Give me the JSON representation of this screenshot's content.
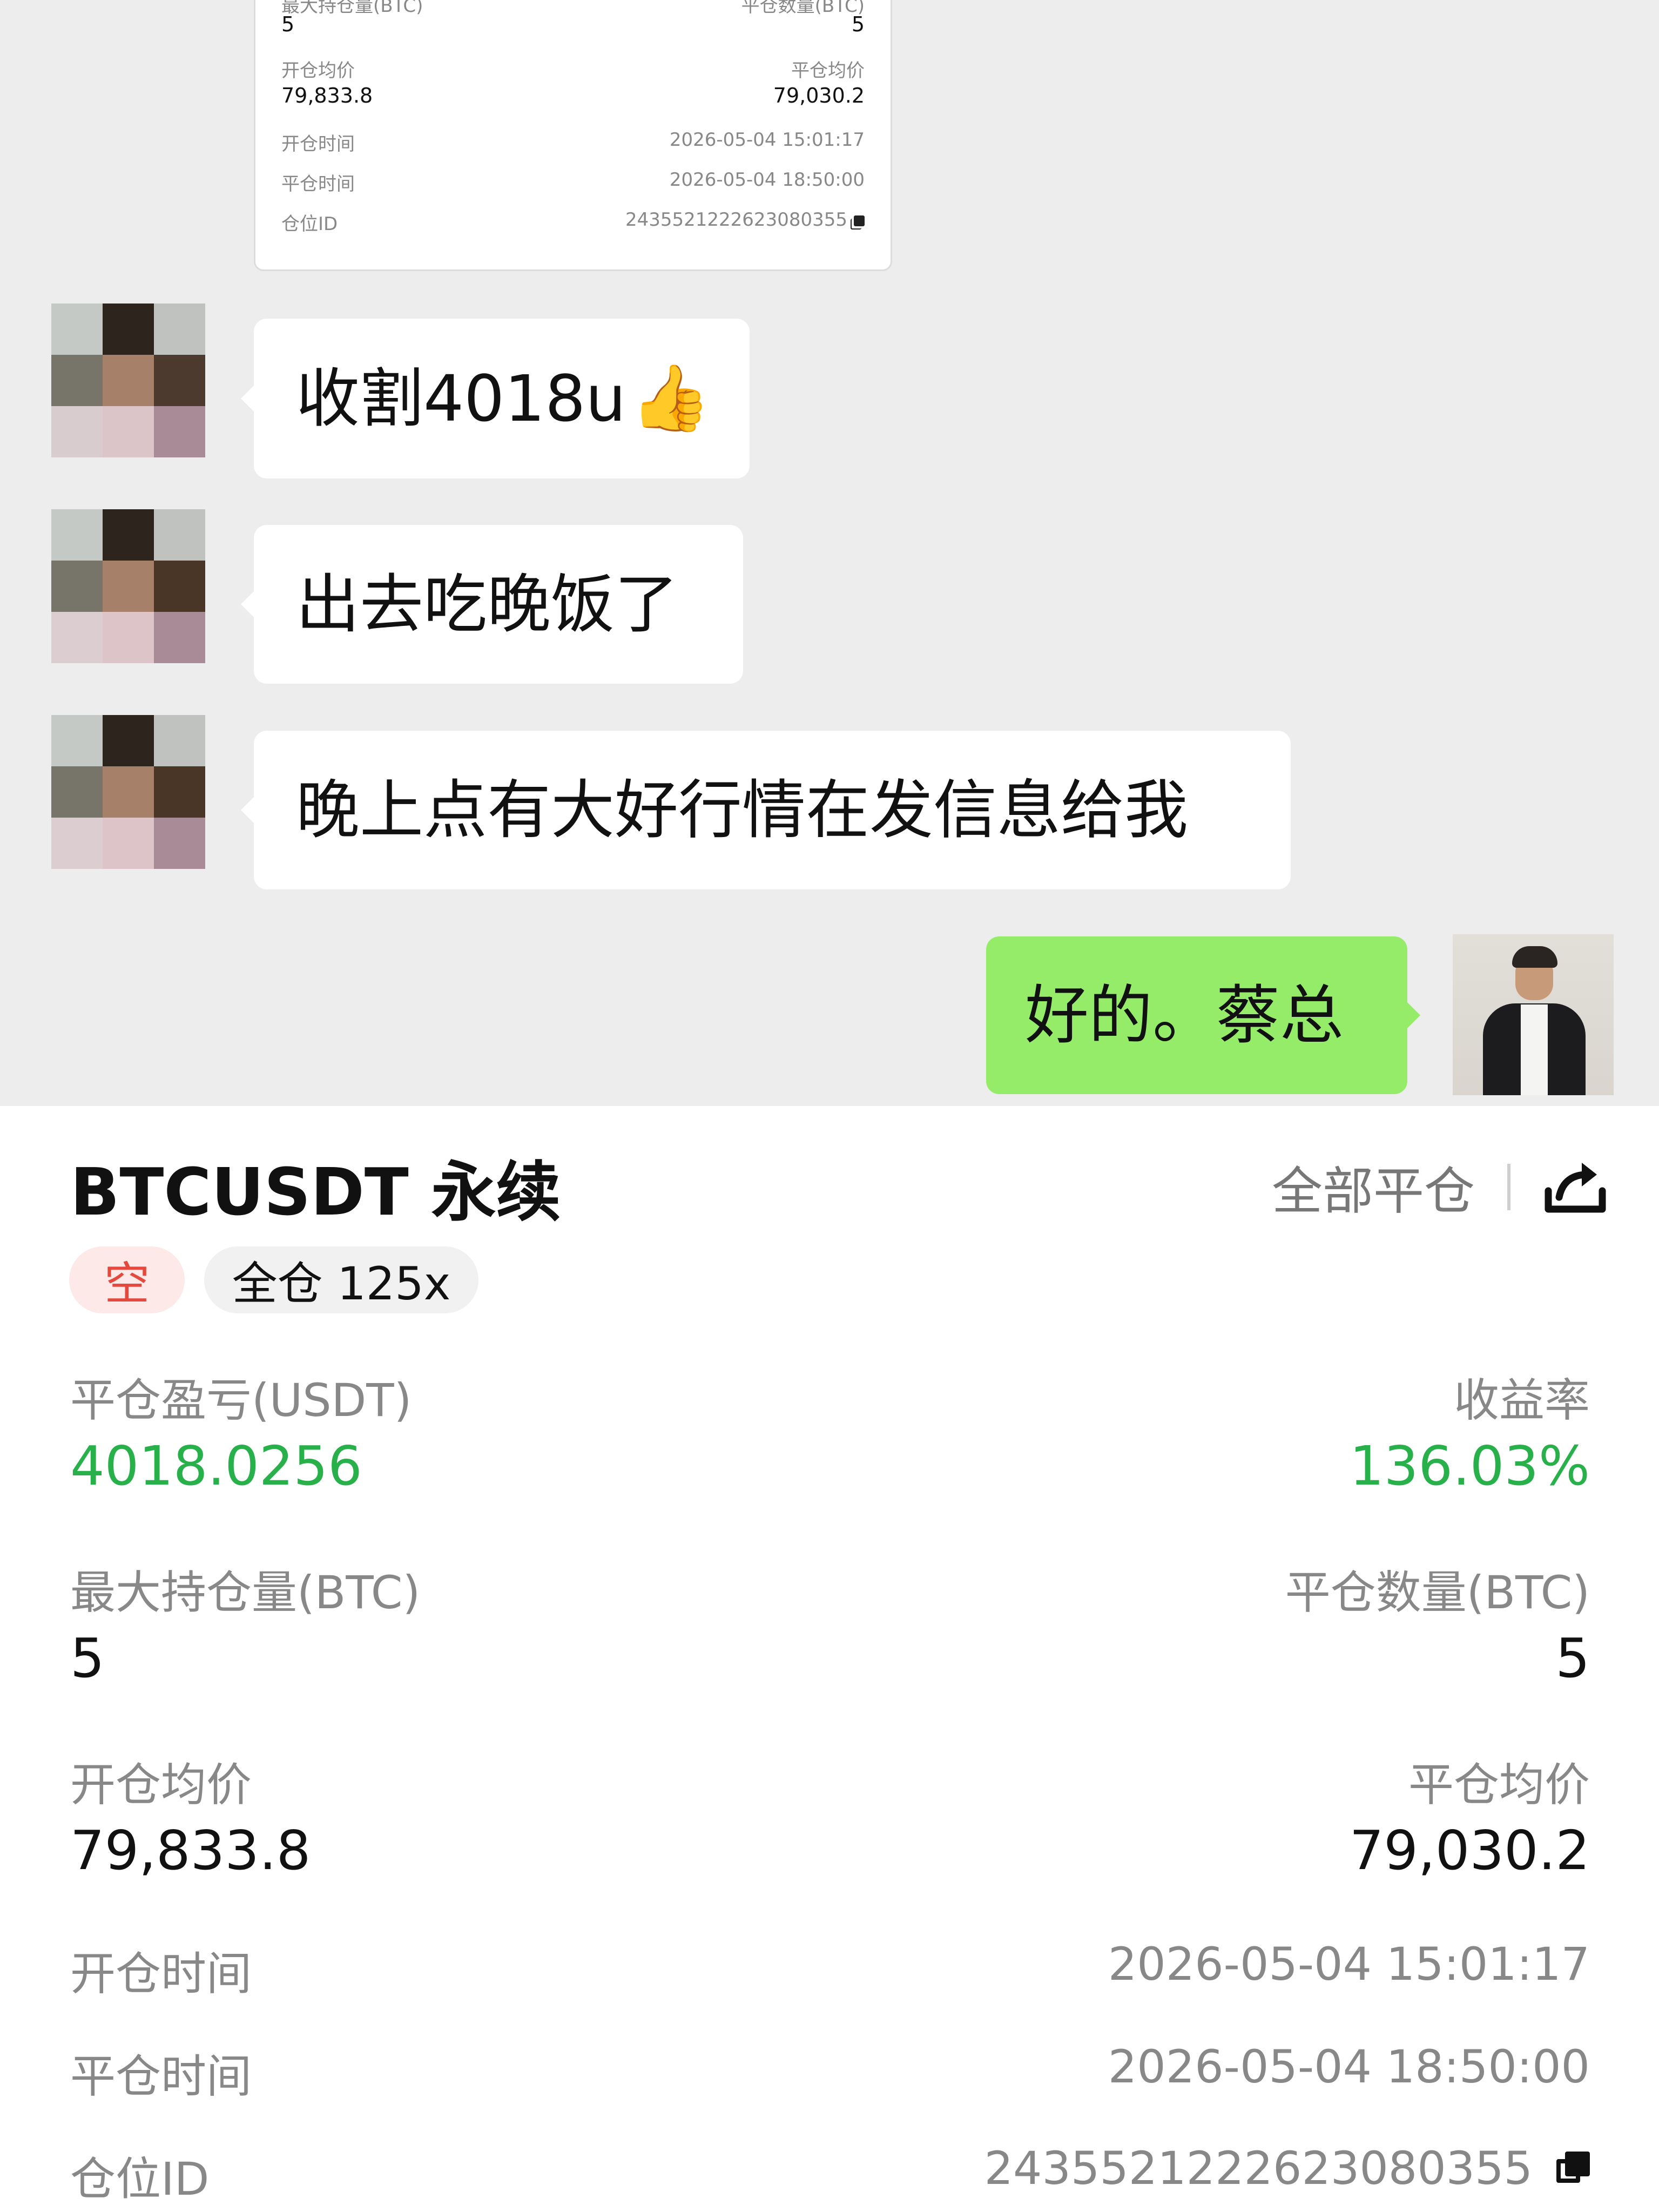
{
  "chat": {
    "mini_card": {
      "max_position_label": "最大持仓量(BTC)",
      "close_qty_label": "平仓数量(BTC)",
      "max_position_value": "5",
      "close_qty_value": "5",
      "open_avg_label": "开仓均价",
      "close_avg_label": "平仓均价",
      "open_avg_value": "79,833.8",
      "close_avg_value": "79,030.2",
      "open_time_label": "开仓时间",
      "open_time_value": "2026-05-04 15:01:17",
      "close_time_label": "平仓时间",
      "close_time_value": "2026-05-04 18:50:00",
      "position_id_label": "仓位ID",
      "position_id_value": "2435521222623080355"
    },
    "messages": [
      {
        "side": "left",
        "text": "收割4018u",
        "emoji": "👍"
      },
      {
        "side": "left",
        "text": "出去吃晚饭了"
      },
      {
        "side": "left",
        "text": "晚上点有大好行情在发信息给我"
      },
      {
        "side": "right",
        "text": "好的。蔡总"
      }
    ],
    "colors": {
      "background": "#ededed",
      "my_bubble": "#95ec69",
      "their_bubble": "#ffffff"
    }
  },
  "panel": {
    "title": "BTCUSDT 永续",
    "close_all_label": "全部平仓",
    "share_icon": "share-icon",
    "tags": {
      "direction": "空",
      "mode": "全仓 125x"
    },
    "pnl_label": "平仓盈亏(USDT)",
    "pnl_value": "4018.0256",
    "roi_label": "收益率",
    "roi_value": "136.03%",
    "max_position_label": "最大持仓量(BTC)",
    "max_position_value": "5",
    "close_qty_label": "平仓数量(BTC)",
    "close_qty_value": "5",
    "open_avg_label": "开仓均价",
    "open_avg_value": "79,833.8",
    "close_avg_label": "平仓均价",
    "close_avg_value": "79,030.2",
    "open_time_label": "开仓时间",
    "open_time_value": "2026-05-04 15:01:17",
    "close_time_label": "平仓时间",
    "close_time_value": "2026-05-04 18:50:00",
    "position_id_label": "仓位ID",
    "position_id_value": "2435521222623080355",
    "copy_icon": "copy-icon",
    "colors": {
      "profit": "#28b04a",
      "short_tag_text": "#e5483d",
      "short_tag_bg": "#fde9e7"
    }
  }
}
